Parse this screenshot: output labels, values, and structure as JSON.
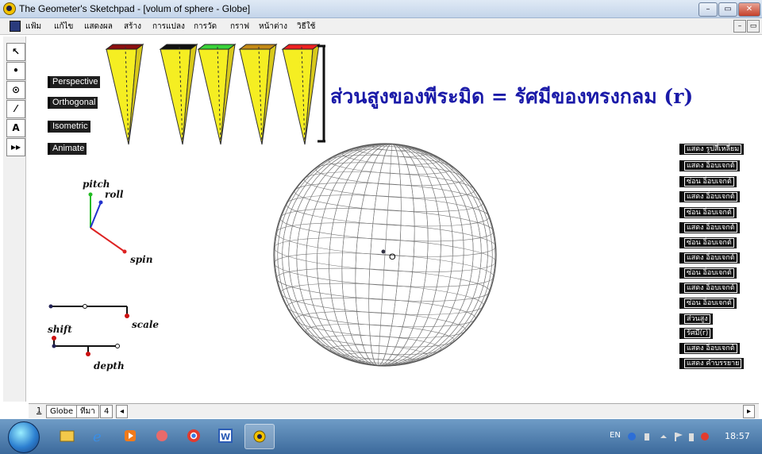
{
  "window": {
    "title": "The Geometer's Sketchpad - [volum of sphere - Globe]",
    "minimize": "–",
    "maximize": "▭",
    "close": "✕"
  },
  "menu": {
    "items": [
      "แฟ้ม",
      "แก้ไข",
      "แสดงผล",
      "สร้าง",
      "การแปลง",
      "การวัด",
      "กราฟ",
      "หน้าต่าง",
      "วิธีใช้"
    ],
    "doc_min": "–",
    "doc_restore": "▭"
  },
  "toolbox": {
    "tools": [
      "↖",
      "•",
      "⊙",
      "⁄",
      "A",
      "▸▸"
    ]
  },
  "view_buttons": [
    "Perspective",
    "Orthogonal",
    "Isometric",
    "Animate"
  ],
  "pyramids": {
    "tops": [
      "#8b1010",
      "#111111",
      "#3ad33a",
      "#c48a16",
      "#ee2222"
    ],
    "body_color": "#f5ee22"
  },
  "caption": "ส่วนสูงของพีระมิด = รัศมีของทรงกลม (r)",
  "axes": {
    "pitch": "pitch",
    "roll": "roll",
    "spin": "spin",
    "colors": {
      "pitch": "#22bb22",
      "roll": "#2233cc",
      "spin": "#dd2222"
    }
  },
  "sliders": {
    "scale": "scale",
    "shift": "shift",
    "depth": "depth"
  },
  "sphere": {
    "center_label": "O"
  },
  "right_buttons": [
    "แสดง รูปสี่เหลี่ยม",
    "แสดง อ็อบเจกต์",
    "ซ่อน อ็อบเจกต์",
    "แสดง อ็อบเจกต์",
    "ซ่อน อ็อบเจกต์",
    "แสดง อ็อบเจกต์",
    "ซ่อน อ็อบเจกต์",
    "แสดง อ็อบเจกต์",
    "ซ่อน อ็อบเจกต์",
    "แสดง อ็อบเจกต์",
    "ซ่อน อ็อบเจกต์",
    "ส่วนสูง",
    "รัศมี(r)",
    "แสดง อ็อบเจกต์",
    "แสดง คำบรรยาย"
  ],
  "tabs": {
    "page_number": "1",
    "items": [
      "Globe",
      "ทีมา",
      "4"
    ],
    "scroll_left": "◂",
    "scroll_right": "▸"
  },
  "taskbar": {
    "lang": "EN",
    "clock": "18:57"
  }
}
